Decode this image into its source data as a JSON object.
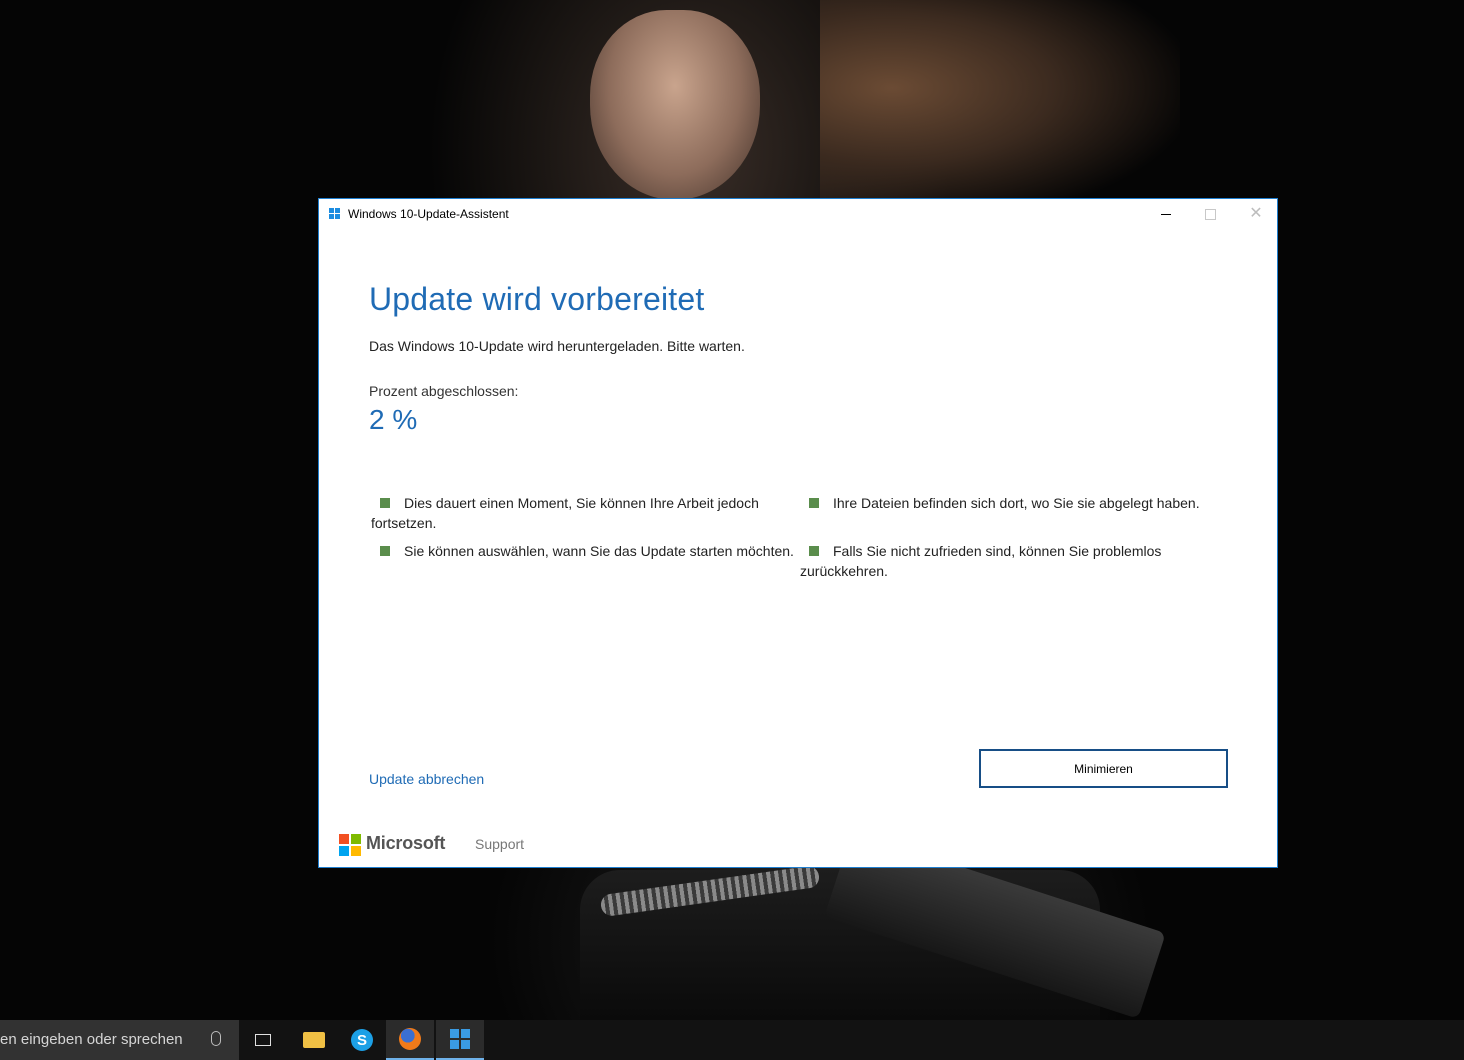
{
  "window": {
    "title": "Windows 10-Update-Assistent",
    "minimize_glyph": "—",
    "close_glyph": "✕"
  },
  "content": {
    "heading": "Update wird vorbereitet",
    "subtext": "Das Windows 10-Update wird heruntergeladen. Bitte warten.",
    "progress_label": "Prozent abgeschlossen:",
    "progress_value": "2 %",
    "progress_percent": 2,
    "bullets": [
      "Dies dauert einen Moment, Sie können Ihre Arbeit jedoch fortsetzen.",
      "Ihre Dateien befinden sich dort, wo Sie sie abgelegt haben.",
      "Sie können auswählen, wann Sie das Update starten möchten.",
      "Falls Sie nicht zufrieden sind, können Sie problemlos zurückkehren."
    ],
    "cancel_link": "Update abbrechen",
    "minimize_button": "Minimieren"
  },
  "footer": {
    "brand": "Microsoft",
    "support_link": "Support"
  },
  "taskbar": {
    "search_text": "en eingeben oder sprechen",
    "skype_glyph": "S"
  },
  "colors": {
    "accent_blue": "#1f6bb5",
    "bullet_green": "#5a8d4c",
    "button_border": "#174e86",
    "ms_red": "#f25022",
    "ms_green": "#7fba00",
    "ms_blue": "#00a4ef",
    "ms_yellow": "#ffb900"
  },
  "icons": [
    "windows-logo-icon",
    "minimize-icon",
    "maximize-icon",
    "close-icon",
    "microsoft-logo-icon",
    "microphone-icon",
    "task-view-icon",
    "file-explorer-icon",
    "skype-icon",
    "firefox-icon"
  ]
}
